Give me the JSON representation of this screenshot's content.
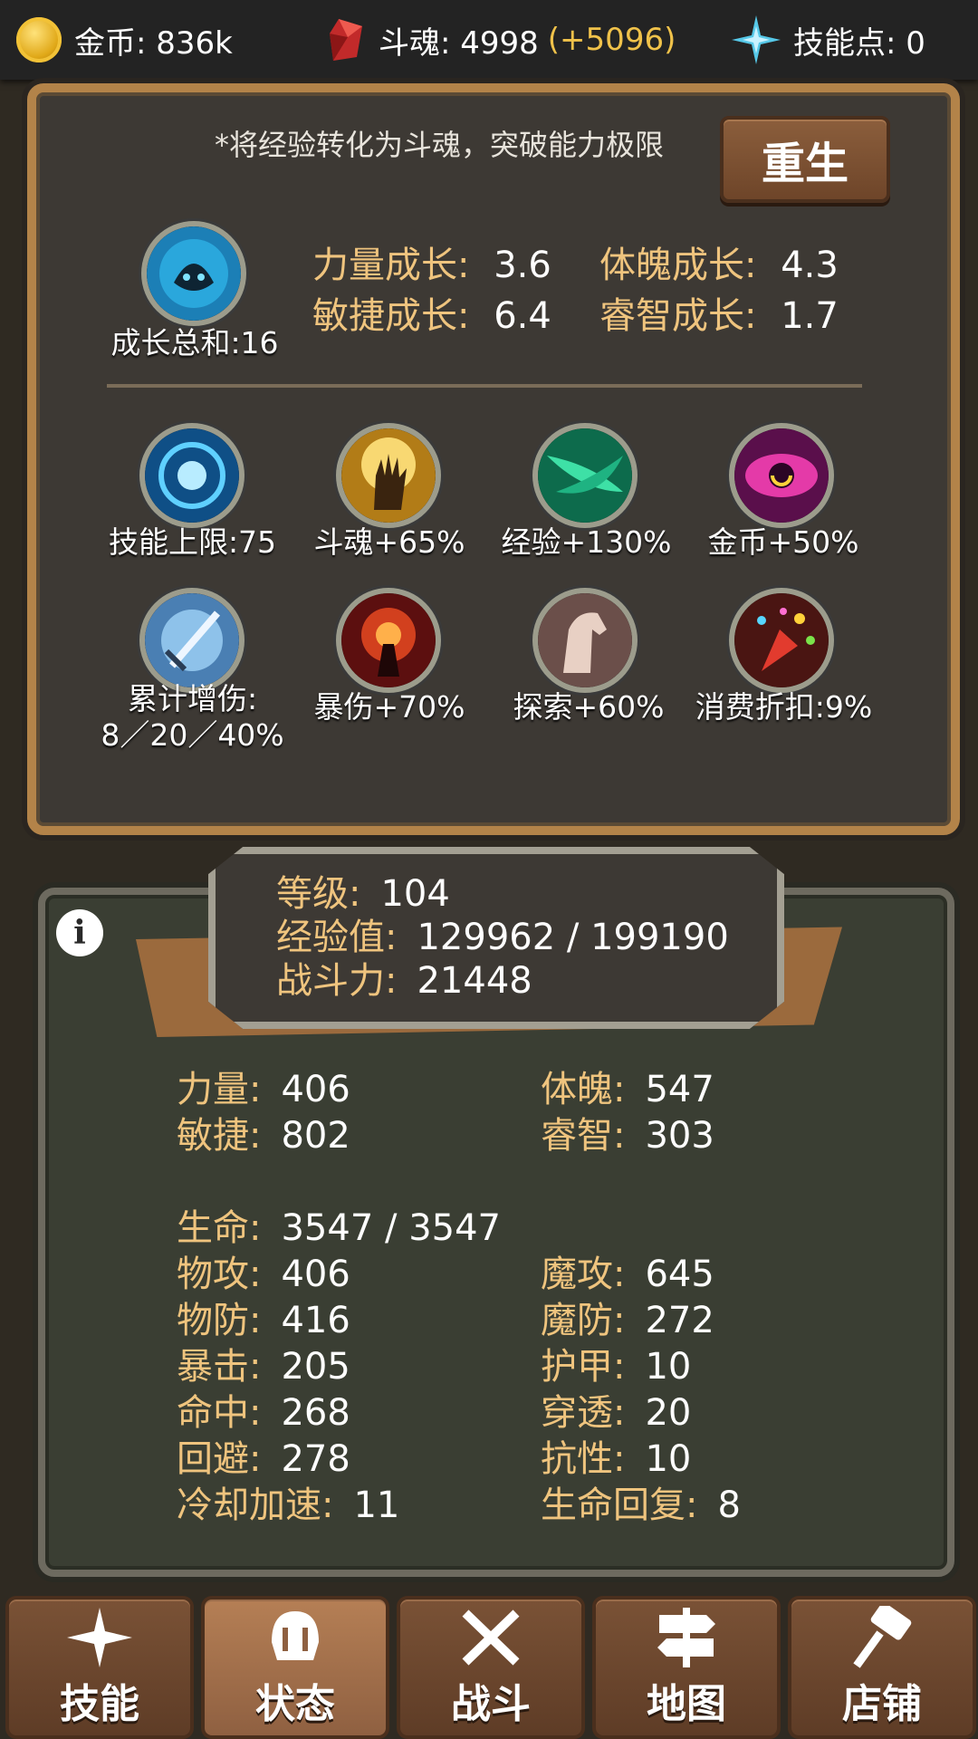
{
  "topbar": {
    "gold_label": "金币: 836k",
    "soul_label": "斗魂: 4998",
    "soul_bonus": "(+5096)",
    "skill_points_label": "技能点: 0"
  },
  "rebirth_panel": {
    "hint": "*将经验转化为斗魂，突破能力极限",
    "rebirth_button": "重生",
    "growth_total": "成长总和:16",
    "growth": [
      {
        "label": "力量成长:",
        "value": "3.6"
      },
      {
        "label": "体魄成长:",
        "value": "4.3"
      },
      {
        "label": "敏捷成长:",
        "value": "6.4"
      },
      {
        "label": "睿智成长:",
        "value": "1.7"
      }
    ],
    "perks": [
      {
        "label": "技能上限:75",
        "icon": "skill-cap-icon"
      },
      {
        "label": "斗魂+65%",
        "icon": "soul-hand-icon"
      },
      {
        "label": "经验+130%",
        "icon": "experience-icon"
      },
      {
        "label": "金币+50%",
        "icon": "gold-eye-icon"
      },
      {
        "label": "累计增伤:",
        "label2": "8／20／40%",
        "icon": "sword-icon"
      },
      {
        "label": "暴伤+70%",
        "icon": "crit-damage-icon"
      },
      {
        "label": "探索+60%",
        "icon": "horse-icon"
      },
      {
        "label": "消费折扣:9%",
        "icon": "party-popper-icon"
      }
    ]
  },
  "status_panel": {
    "level_label": "等级:",
    "level_value": "104",
    "exp_label": "经验值:",
    "exp_value": "129962 / 199190",
    "power_label": "战斗力:",
    "power_value": "21448",
    "attributes": [
      {
        "k": "力量:",
        "v": "406"
      },
      {
        "k": "体魄:",
        "v": "547"
      },
      {
        "k": "敏捷:",
        "v": "802"
      },
      {
        "k": "睿智:",
        "v": "303"
      }
    ],
    "hp": {
      "k": "生命:",
      "v": "3547 / 3547"
    },
    "stats": [
      {
        "k": "物攻:",
        "v": "406"
      },
      {
        "k": "魔攻:",
        "v": "645"
      },
      {
        "k": "物防:",
        "v": "416"
      },
      {
        "k": "魔防:",
        "v": "272"
      },
      {
        "k": "暴击:",
        "v": "205"
      },
      {
        "k": "护甲:",
        "v": "10"
      },
      {
        "k": "命中:",
        "v": "268"
      },
      {
        "k": "穿透:",
        "v": "20"
      },
      {
        "k": "回避:",
        "v": "278"
      },
      {
        "k": "抗性:",
        "v": "10"
      },
      {
        "k": "冷却加速:",
        "v": "11"
      },
      {
        "k": "生命回复:",
        "v": "8"
      }
    ]
  },
  "nav": [
    {
      "label": "技能",
      "icon": "sparkle-icon"
    },
    {
      "label": "状态",
      "icon": "helmet-icon"
    },
    {
      "label": "战斗",
      "icon": "crossed-swords-icon"
    },
    {
      "label": "地图",
      "icon": "signpost-icon"
    },
    {
      "label": "店铺",
      "icon": "hammer-icon"
    }
  ],
  "colors": {
    "accent_gold": "#efc47e",
    "bonus_yellow": "#f0c24a",
    "nav_active": "#b57f55"
  }
}
